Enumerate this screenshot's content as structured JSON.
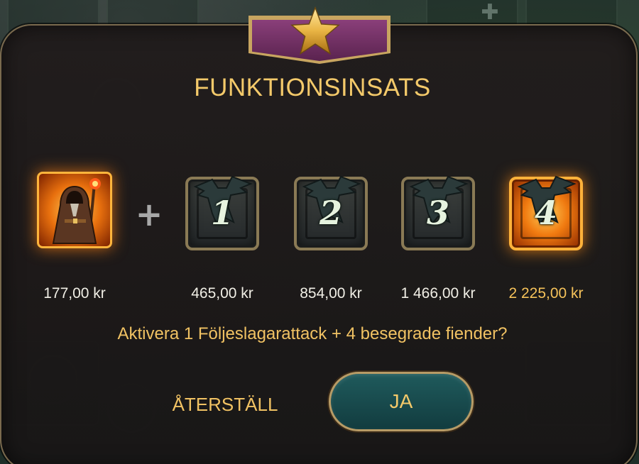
{
  "dialog": {
    "title": "FUNKTIONSINSATS",
    "emblem_icon": "star-icon",
    "base_symbol": {
      "icon": "wizard-icon",
      "price": "177,00 kr"
    },
    "plus_icon": "plus-icon",
    "levels": [
      {
        "number": "1",
        "price": "465,00 kr",
        "selected": false
      },
      {
        "number": "2",
        "price": "854,00 kr",
        "selected": false
      },
      {
        "number": "3",
        "price": "1 466,00 kr",
        "selected": false
      },
      {
        "number": "4",
        "price": "2 225,00 kr",
        "selected": true
      }
    ],
    "question": "Aktivera 1 Följeslagarattack + 4 besegrade fiender?",
    "reset_label": "ÅTERSTÄLL",
    "confirm_label": "JA"
  },
  "colors": {
    "accent_gold": "#f1c263",
    "ribbon_purple": "#6a2a5e",
    "button_teal": "#1a4d50",
    "active_orange": "#f07a10"
  }
}
